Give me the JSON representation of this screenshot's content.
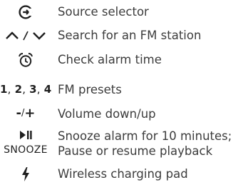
{
  "legend": {
    "rows": [
      {
        "icon": "source-selector-icon",
        "description": "Source selector"
      },
      {
        "icon": "search-up-down-icon",
        "description": "Search for an FM station"
      },
      {
        "icon": "alarm-clock-icon",
        "description": "Check alarm time"
      },
      {
        "symbol": [
          "1",
          "2",
          "3",
          "4"
        ],
        "description": "FM presets"
      },
      {
        "symbol_minus": "-",
        "symbol_slash": "/",
        "symbol_plus": "+",
        "description": "Volume down/up"
      },
      {
        "icon": "play-pause-icon",
        "symbol": "SNOOZE",
        "description_line1": "Snooze alarm for 10 minutes;",
        "description_line2": "Pause or resume playback"
      },
      {
        "icon": "lightning-icon",
        "description": "Wireless charging pad"
      }
    ]
  }
}
